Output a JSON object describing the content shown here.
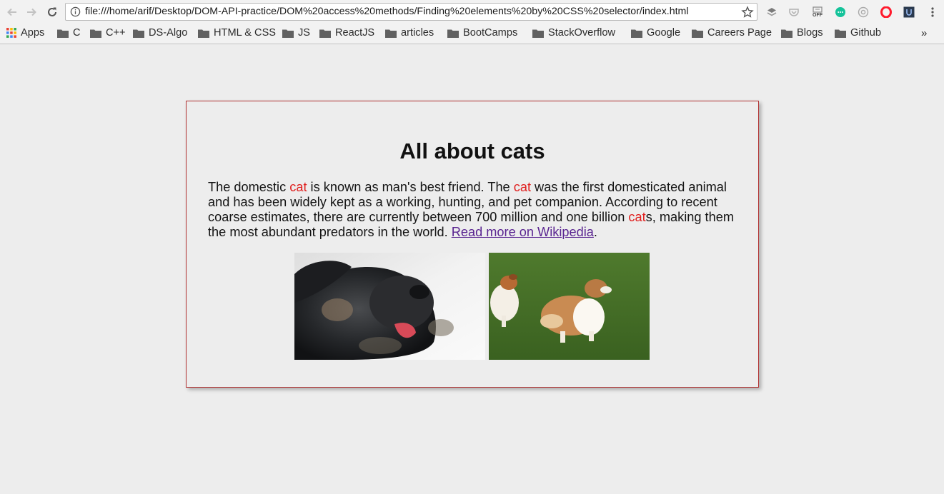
{
  "browser": {
    "url": "file:///home/arif/Desktop/DOM-API-practice/DOM%20access%20methods/Finding%20elements%20by%20CSS%20selector/index.html",
    "extension_off_label": "OFF",
    "bookmarks": [
      "Apps",
      "C",
      "C++",
      "DS-Algo",
      "HTML & CSS",
      "JS",
      "ReactJS",
      "articles",
      "BootCamps",
      "StackOverflow",
      "Google",
      "Careers Page",
      "Blogs",
      "Github"
    ],
    "more_bookmarks": "»",
    "icons": [
      "back-icon",
      "forward-icon",
      "reload-icon",
      "info-icon",
      "star-icon",
      "apps-grid-icon",
      "folder-icon",
      "menu-icon"
    ]
  },
  "page": {
    "title": "All about cats",
    "paragraph": {
      "t1": "The domestic ",
      "h1": "cat",
      "t2": " is known as man's best friend. The ",
      "h2": "cat",
      "t3": " was the first domesticated animal and has been widely kept as a working, hunting, and pet companion. According to recent coarse estimates, there are currently between 700 million and one billion ",
      "h3": "cat",
      "t4": "s, making them the most abundant predators in the world. ",
      "link": "Read more on Wikipedia",
      "t5": "."
    },
    "highlight_color": "#e0201f",
    "border_color": "#b23434"
  }
}
